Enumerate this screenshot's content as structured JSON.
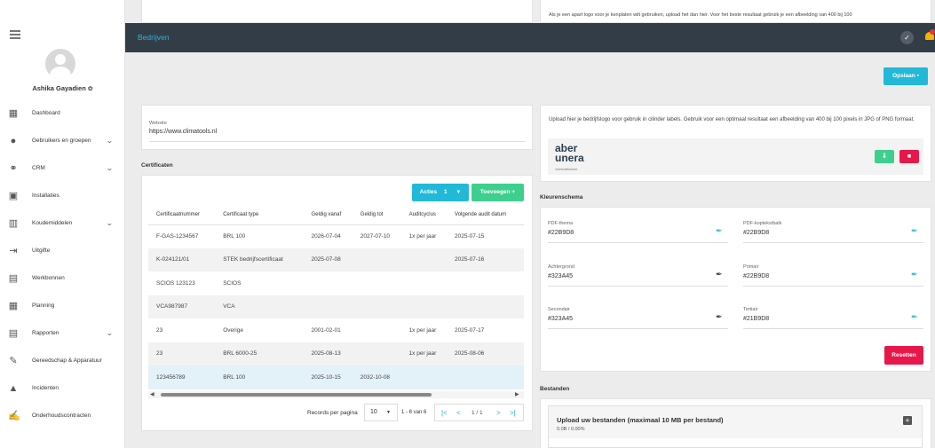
{
  "user": {
    "name": "Ashika Gayadien"
  },
  "nav": [
    {
      "label": "Dashboard",
      "icon": "dashboard-icon",
      "chevron": false
    },
    {
      "label": "Gebruikers en groepen",
      "icon": "user-icon",
      "chevron": true
    },
    {
      "label": "CRM",
      "icon": "handshake-icon",
      "chevron": true
    },
    {
      "label": "Installaties",
      "icon": "installations-icon",
      "chevron": false
    },
    {
      "label": "Koudemiddelen",
      "icon": "building-icon",
      "chevron": true
    },
    {
      "label": "Uitgifte",
      "icon": "sign-out-icon",
      "chevron": false
    },
    {
      "label": "Werkbonnen",
      "icon": "clipboard-icon",
      "chevron": false
    },
    {
      "label": "Planning",
      "icon": "calendar-icon",
      "chevron": false
    },
    {
      "label": "Rapporten",
      "icon": "report-icon",
      "chevron": true
    },
    {
      "label": "Gereedschap & Apparatuur",
      "icon": "wrench-icon",
      "chevron": false
    },
    {
      "label": "Incidenten",
      "icon": "warning-icon",
      "chevron": false
    },
    {
      "label": "Onderhoudscontracten",
      "icon": "contract-icon",
      "chevron": false
    }
  ],
  "header": {
    "title": "Bedrijven"
  },
  "top_note": "Als je een apart logo voor je kenplaten wilt gebruiken, upload het dan hier. Voor het beste resultaat gebruik je een afbeelding van 400 bij 100",
  "save_label": "Opslaan",
  "website": {
    "label": "Website",
    "value": "https://www.climatools.nl"
  },
  "certificates": {
    "title": "Certificaten",
    "actions_label": "Acties",
    "actions_count": "1",
    "add_label": "Toevoegen",
    "columns": [
      "Certificaatnummer",
      "Certificaat type",
      "Geldig vanaf",
      "Geldig tot",
      "Auditcyclus",
      "Volgende audit datum"
    ],
    "rows": [
      [
        "F-GAS-1234567",
        "BRL 100",
        "2026-07-04",
        "2027-07-10",
        "1x per jaar",
        "2025-07-15"
      ],
      [
        "K-024121/01",
        "STEK bedrijfscertificaat",
        "2025-07-08",
        "",
        "",
        "2025-07-16"
      ],
      [
        "SCIOS 123123",
        "SCIOS",
        "",
        "",
        "",
        ""
      ],
      [
        "VCA987987",
        "VCA",
        "",
        "",
        "",
        ""
      ],
      [
        "23",
        "Overige",
        "2001-02-01",
        "",
        "1x per jaar",
        "2025-07-17"
      ],
      [
        "23",
        "BRL 6000-25",
        "2025-08-13",
        "",
        "1x per jaar",
        "2025-08-06"
      ],
      [
        "123456789",
        "BRL 100",
        "2025-10-15",
        "2032-10-08",
        "",
        ""
      ]
    ],
    "records_label": "Records per pagina",
    "records_value": "10",
    "range_label": "1 - 6 van 6",
    "page_label": "1 / 1"
  },
  "logo": {
    "note": "Upload hier je bedrijfslogo voor gebruik in cilinder labels. Gebruik voor een optimaal resultaat een afbeelding van 400 bij 100 pixels in JPG of PNG formaat.",
    "text_line1": "aber",
    "text_line2": "unera",
    "text_sub": "veerboeilbeland"
  },
  "color_scheme": {
    "title": "Kleurenschema",
    "fields": [
      {
        "label": "PDF-thema",
        "value": "#22B9D8",
        "swatch": "#22B9D8"
      },
      {
        "label": "PDF-koptekstbalk",
        "value": "#22B9D8",
        "swatch": "#22B9D8"
      },
      {
        "label": "Achtergrond",
        "value": "#323A45",
        "swatch": "#323A45"
      },
      {
        "label": "Primair",
        "value": "#22B9D8",
        "swatch": "#22B9D8"
      },
      {
        "label": "Secondair",
        "value": "#323A45",
        "swatch": "#323A45"
      },
      {
        "label": "Tertiair",
        "value": "#21B9D8",
        "swatch": "#21B9D8"
      }
    ],
    "reset_label": "Resetten"
  },
  "files": {
    "title": "Bestanden",
    "upload_title": "Upload uw bestanden (maximaal 10 MB per bestand)",
    "progress": "0.0B / 0.00%"
  },
  "colors": {
    "accent": "#22b9d8",
    "topbar": "#333d48",
    "add_green": "#3ecf8e",
    "danger": "#e8174a"
  }
}
